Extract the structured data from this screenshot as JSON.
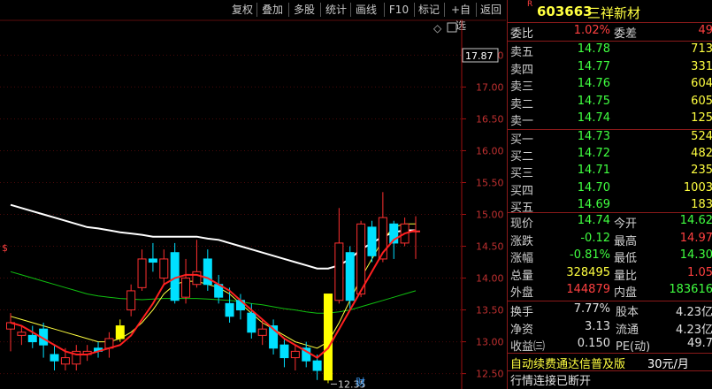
{
  "toolbar": {
    "buttons": [
      "复权",
      "叠加",
      "多股",
      "统计",
      "画线",
      "F10",
      "标记",
      "+自选",
      "返回"
    ]
  },
  "chart": {
    "price_label_current": "17.87",
    "y_ticks": [
      "17.50",
      "17.00",
      "16.50",
      "16.00",
      "15.50",
      "15.00",
      "14.50",
      "14.00",
      "13.50",
      "13.00",
      "12.50"
    ],
    "low_label": "12.35",
    "finance_marker": "财",
    "left_marker": "$",
    "diamond": "◇",
    "box_icon": "square-icon"
  },
  "chart_data": {
    "type": "candlestick",
    "y_ticks": [
      17.5,
      17.0,
      16.5,
      16.0,
      15.5,
      15.0,
      14.5,
      14.0,
      13.5,
      13.0,
      12.5
    ],
    "ylim": [
      12.3,
      17.95
    ],
    "candles": [
      {
        "o": 13.2,
        "c": 13.3,
        "h": 13.45,
        "l": 12.85
      },
      {
        "o": 13.1,
        "c": 13.15,
        "h": 13.25,
        "l": 12.95
      },
      {
        "o": 13.1,
        "c": 13.0,
        "h": 13.25,
        "l": 12.9
      },
      {
        "o": 13.2,
        "c": 12.95,
        "h": 13.3,
        "l": 12.75
      },
      {
        "o": 12.8,
        "c": 12.7,
        "h": 12.95,
        "l": 12.55
      },
      {
        "o": 12.65,
        "c": 12.75,
        "h": 12.9,
        "l": 12.55
      },
      {
        "o": 12.65,
        "c": 12.85,
        "h": 12.95,
        "l": 12.55
      },
      {
        "o": 12.8,
        "c": 12.85,
        "h": 12.95,
        "l": 12.7
      },
      {
        "o": 12.9,
        "c": 12.85,
        "h": 13.0,
        "l": 12.75
      },
      {
        "o": 12.9,
        "c": 13.05,
        "h": 13.15,
        "l": 12.75
      },
      {
        "o": 13.05,
        "c": 13.25,
        "h": 13.35,
        "l": 13.0
      },
      {
        "o": 13.5,
        "c": 13.8,
        "h": 13.9,
        "l": 13.4
      },
      {
        "o": 13.85,
        "c": 14.3,
        "h": 14.45,
        "l": 13.8
      },
      {
        "o": 14.3,
        "c": 14.25,
        "h": 14.55,
        "l": 14.1
      },
      {
        "o": 14.0,
        "c": 14.3,
        "h": 14.45,
        "l": 13.9
      },
      {
        "o": 14.4,
        "c": 13.65,
        "h": 14.55,
        "l": 13.6
      },
      {
        "o": 13.7,
        "c": 14.0,
        "h": 14.3,
        "l": 13.6
      },
      {
        "o": 13.9,
        "c": 14.1,
        "h": 14.6,
        "l": 13.85
      },
      {
        "o": 14.3,
        "c": 13.9,
        "h": 14.45,
        "l": 13.8
      },
      {
        "o": 13.9,
        "c": 13.7,
        "h": 14.05,
        "l": 13.6
      },
      {
        "o": 13.6,
        "c": 13.4,
        "h": 13.85,
        "l": 13.3
      },
      {
        "o": 13.65,
        "c": 13.5,
        "h": 13.75,
        "l": 13.35
      },
      {
        "o": 13.45,
        "c": 13.15,
        "h": 13.6,
        "l": 13.05
      },
      {
        "o": 13.1,
        "c": 13.2,
        "h": 13.35,
        "l": 12.95
      },
      {
        "o": 13.25,
        "c": 12.9,
        "h": 13.35,
        "l": 12.8
      },
      {
        "o": 12.95,
        "c": 12.75,
        "h": 13.05,
        "l": 12.6
      },
      {
        "o": 12.75,
        "c": 12.85,
        "h": 12.95,
        "l": 12.55
      },
      {
        "o": 12.9,
        "c": 12.7,
        "h": 13.0,
        "l": 12.6
      },
      {
        "o": 12.7,
        "c": 12.55,
        "h": 12.8,
        "l": 12.4
      },
      {
        "o": 12.4,
        "c": 13.75,
        "h": 13.75,
        "l": 12.35
      },
      {
        "o": 13.65,
        "c": 14.55,
        "h": 15.1,
        "l": 13.6
      },
      {
        "o": 14.4,
        "c": 13.65,
        "h": 14.5,
        "l": 13.5
      },
      {
        "o": 13.75,
        "c": 14.85,
        "h": 14.9,
        "l": 13.7
      },
      {
        "o": 14.8,
        "c": 14.35,
        "h": 14.9,
        "l": 14.25
      },
      {
        "o": 14.3,
        "c": 14.95,
        "h": 15.35,
        "l": 14.25
      },
      {
        "o": 14.85,
        "c": 14.55,
        "h": 14.9,
        "l": 14.3
      },
      {
        "o": 14.55,
        "c": 14.85,
        "h": 14.95,
        "l": 14.5
      },
      {
        "o": 14.74,
        "c": 14.74,
        "h": 14.97,
        "l": 14.3
      }
    ],
    "ma_short": [
      13.3,
      13.25,
      13.15,
      13.05,
      12.95,
      12.85,
      12.8,
      12.8,
      12.85,
      12.9,
      12.95,
      13.1,
      13.35,
      13.6,
      13.9,
      14.0,
      14.05,
      14.05,
      14.0,
      13.9,
      13.8,
      13.65,
      13.5,
      13.35,
      13.2,
      13.05,
      12.95,
      12.85,
      12.75,
      12.9,
      13.2,
      13.5,
      13.8,
      14.1,
      14.4,
      14.6,
      14.7,
      14.75
    ],
    "ma_mid": [
      13.4,
      13.35,
      13.3,
      13.25,
      13.2,
      13.15,
      13.1,
      13.05,
      13.0,
      13.0,
      13.05,
      13.15,
      13.3,
      13.5,
      13.75,
      13.9,
      13.95,
      13.95,
      13.9,
      13.85,
      13.75,
      13.6,
      13.45,
      13.3,
      13.2,
      13.1,
      13.0,
      12.95,
      12.9,
      13.0,
      13.3,
      13.65,
      14.0,
      14.3,
      14.6,
      14.8,
      14.85,
      14.85
    ],
    "ma_long": [
      15.15,
      15.1,
      15.05,
      15.0,
      14.95,
      14.9,
      14.85,
      14.8,
      14.78,
      14.75,
      14.72,
      14.7,
      14.68,
      14.65,
      14.65,
      14.65,
      14.65,
      14.65,
      14.62,
      14.6,
      14.55,
      14.5,
      14.45,
      14.4,
      14.35,
      14.3,
      14.25,
      14.2,
      14.15,
      14.15,
      14.2,
      14.3,
      14.45,
      14.55,
      14.65,
      14.72,
      14.75,
      14.75
    ],
    "ma_green": [
      14.1,
      14.05,
      14.0,
      13.95,
      13.9,
      13.85,
      13.8,
      13.75,
      13.72,
      13.7,
      13.68,
      13.67,
      13.66,
      13.67,
      13.68,
      13.68,
      13.68,
      13.68,
      13.67,
      13.66,
      13.65,
      13.63,
      13.6,
      13.58,
      13.55,
      13.52,
      13.5,
      13.47,
      13.45,
      13.45,
      13.47,
      13.5,
      13.55,
      13.6,
      13.65,
      13.7,
      13.75,
      13.8
    ]
  },
  "quote": {
    "code": "603663",
    "name": "三祥新材",
    "r_mark": "R",
    "weibi_label": "委比",
    "weibi": "1.02%",
    "weicha_label": "委差",
    "weicha": "49",
    "asks": [
      {
        "label": "卖五",
        "price": "14.78",
        "vol": "713"
      },
      {
        "label": "卖四",
        "price": "14.77",
        "vol": "331"
      },
      {
        "label": "卖三",
        "price": "14.76",
        "vol": "604"
      },
      {
        "label": "卖二",
        "price": "14.75",
        "vol": "605"
      },
      {
        "label": "卖一",
        "price": "14.74",
        "vol": "125"
      }
    ],
    "bids": [
      {
        "label": "买一",
        "price": "14.73",
        "vol": "524"
      },
      {
        "label": "买二",
        "price": "14.72",
        "vol": "482"
      },
      {
        "label": "买三",
        "price": "14.71",
        "vol": "235"
      },
      {
        "label": "买四",
        "price": "14.70",
        "vol": "1003"
      },
      {
        "label": "买五",
        "price": "14.69",
        "vol": "183"
      }
    ],
    "stats": [
      {
        "l1": "现价",
        "v1": "14.74",
        "c1": "grn",
        "l2": "今开",
        "v2": "14.62",
        "c2": "grn"
      },
      {
        "l1": "涨跌",
        "v1": "-0.12",
        "c1": "grn",
        "l2": "最高",
        "v2": "14.97",
        "c2": "red"
      },
      {
        "l1": "涨幅",
        "v1": "-0.81%",
        "c1": "grn",
        "l2": "最低",
        "v2": "14.30",
        "c2": "grn"
      },
      {
        "l1": "总量",
        "v1": "328495",
        "c1": "yel",
        "l2": "量比",
        "v2": "1.05",
        "c2": "red"
      },
      {
        "l1": "外盘",
        "v1": "144879",
        "c1": "red",
        "l2": "内盘",
        "v2": "183616",
        "c2": "grn"
      }
    ],
    "stats2": [
      {
        "l1": "换手",
        "v1": "7.77%",
        "l2": "股本",
        "v2": "4.23亿"
      },
      {
        "l1": "净资",
        "v1": "3.13",
        "l2": "流通",
        "v2": "4.23亿"
      },
      {
        "l1": "收益㈢",
        "v1": "0.150",
        "l2": "PE(动)",
        "v2": "49.7"
      }
    ],
    "ad_text": "自动续费通达信普及版",
    "ad_price": "30元/月",
    "status": "行情连接已断开"
  },
  "colors": {
    "up": "#ff3030",
    "down": "#00e0ff",
    "yellow_candle": "#ffff00",
    "ma_white": "#ffffff",
    "ma_yellow": "#ffff40",
    "ma_green": "#10c010",
    "axis": "#a01010"
  }
}
